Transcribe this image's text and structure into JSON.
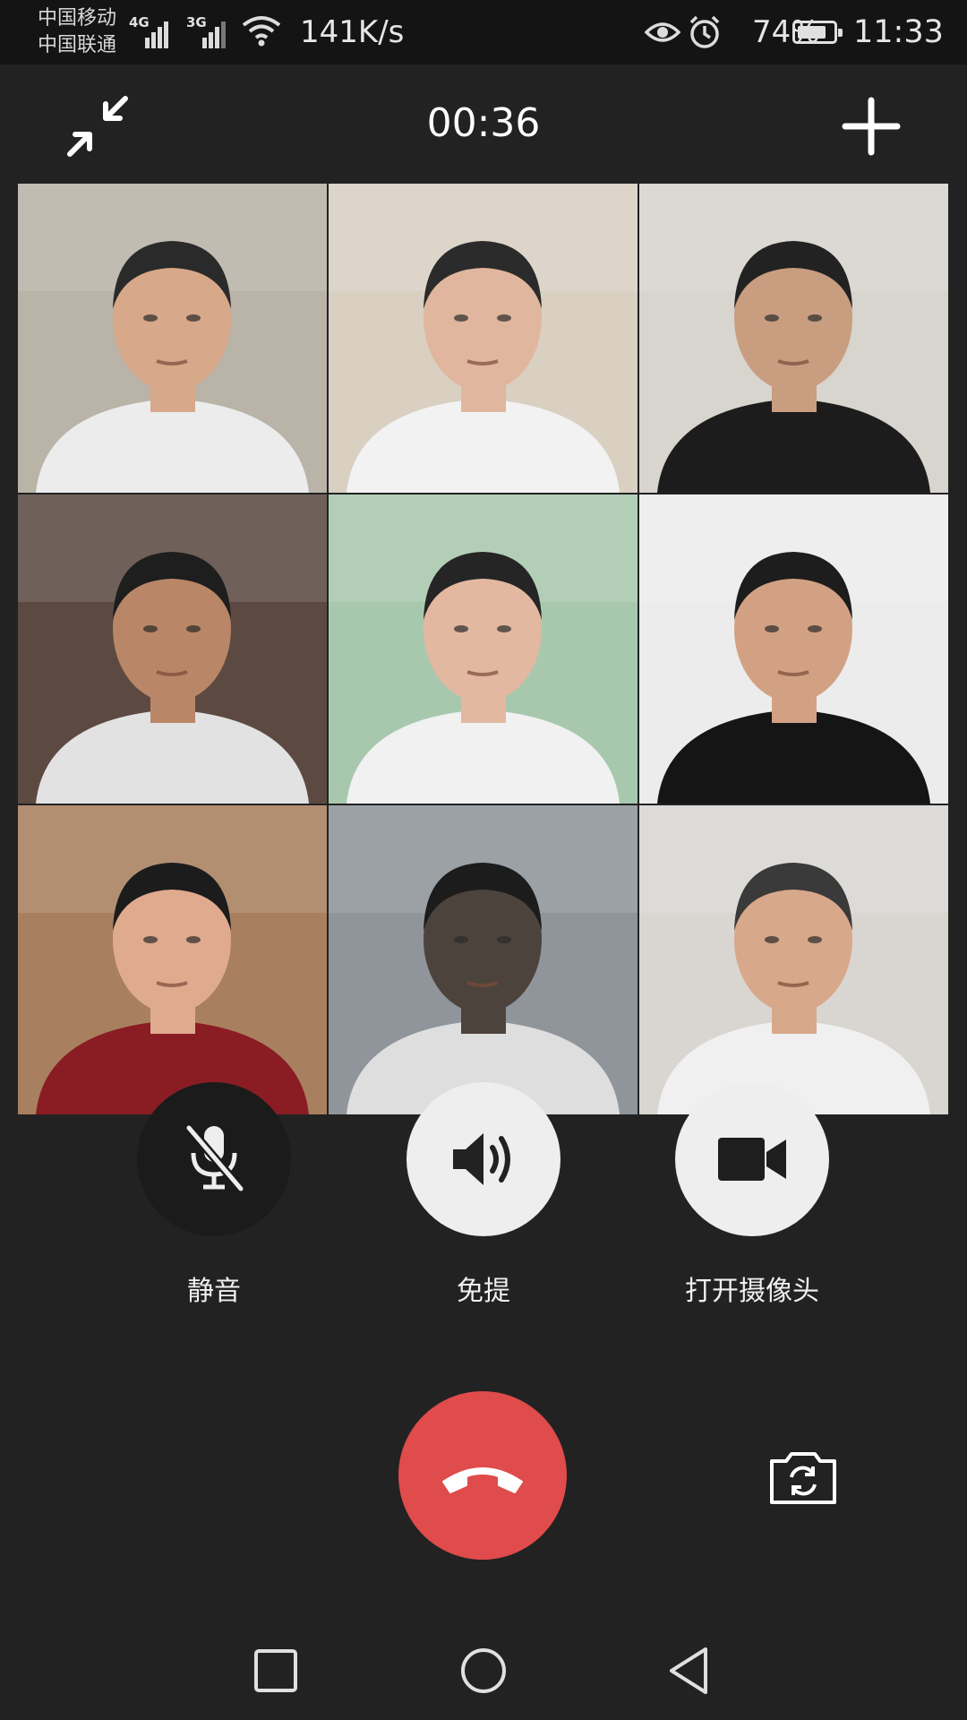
{
  "status_bar": {
    "carrier_1": "中国移动",
    "carrier_2": "中国联通",
    "network_1": "4G",
    "network_2": "3G",
    "speed": "141K/s",
    "battery": "74%",
    "time": "11:33",
    "icons": [
      "signal-icon",
      "wifi-icon",
      "eye-icon",
      "alarm-icon",
      "battery-icon"
    ]
  },
  "call": {
    "duration": "00:36"
  },
  "participants": [
    {
      "bg": "#b9b3a8",
      "shirt": "#ececec",
      "skin": "#d7a889",
      "hair": "#2a2a2a"
    },
    {
      "bg": "#d9d0c2",
      "shirt": "#f2f2f2",
      "skin": "#e0b79e",
      "hair": "#2b2b2b"
    },
    {
      "bg": "#d8d4ce",
      "shirt": "#1c1c1c",
      "skin": "#c99d80",
      "hair": "#222222"
    },
    {
      "bg": "#5c4a42",
      "shirt": "#e2e2e2",
      "skin": "#b98767",
      "hair": "#1e1e1e"
    },
    {
      "bg": "#a8c8ae",
      "shirt": "#f1f1f1",
      "skin": "#e3b8a0",
      "hair": "#252525"
    },
    {
      "bg": "#ececec",
      "shirt": "#151515",
      "skin": "#d2a183",
      "hair": "#1d1d1d"
    },
    {
      "bg": "#a9805f",
      "shirt": "#8a1d24",
      "skin": "#e0aa8e",
      "hair": "#1c1c1c"
    },
    {
      "bg": "#8f959a",
      "shirt": "#dedede",
      "skin": "#4d433d",
      "hair": "#1c1c1c"
    },
    {
      "bg": "#d9d6d2",
      "shirt": "#f0f0f0",
      "skin": "#d8a88a",
      "hair": "#3a3a3a"
    }
  ],
  "controls": {
    "mute_label": "静音",
    "speaker_label": "免提",
    "camera_label": "打开摄像头"
  },
  "colors": {
    "background": "#222222",
    "status_bar": "#141414",
    "hangup": "#e04b4b",
    "button_light": "#eeeeee",
    "button_dark": "#1b1b1b"
  }
}
